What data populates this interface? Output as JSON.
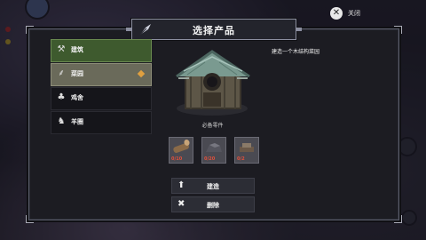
{
  "title": "选择产品",
  "close": {
    "label": "关闭",
    "icon": "close-icon"
  },
  "categories": [
    {
      "label": "建筑",
      "icon": "hammer-icon",
      "state": "active"
    },
    {
      "label": "菜园",
      "icon": "plant-icon",
      "state": "selected",
      "badge": "diamond-badge-icon"
    },
    {
      "label": "鸡舍",
      "icon": "chicken-icon",
      "state": "normal"
    },
    {
      "label": "羊圈",
      "icon": "sheep-icon",
      "state": "normal"
    }
  ],
  "requirements_label": "必备零件",
  "resources": [
    {
      "name": "log-icon",
      "count": "0/10"
    },
    {
      "name": "stone-icon",
      "count": "0/20"
    },
    {
      "name": "tool-icon",
      "count": "0/2"
    }
  ],
  "description": "建造一个木结构菜园",
  "buttons": {
    "build": {
      "label": "建造",
      "icon": "arrow-up-icon"
    },
    "delete": {
      "label": "删除",
      "icon": "cross-icon"
    }
  },
  "colors": {
    "active_category": "#3e5a2e",
    "selected_category": "#6a6a5a",
    "badge": "#e0a040",
    "resource_count": "#e0503c"
  }
}
